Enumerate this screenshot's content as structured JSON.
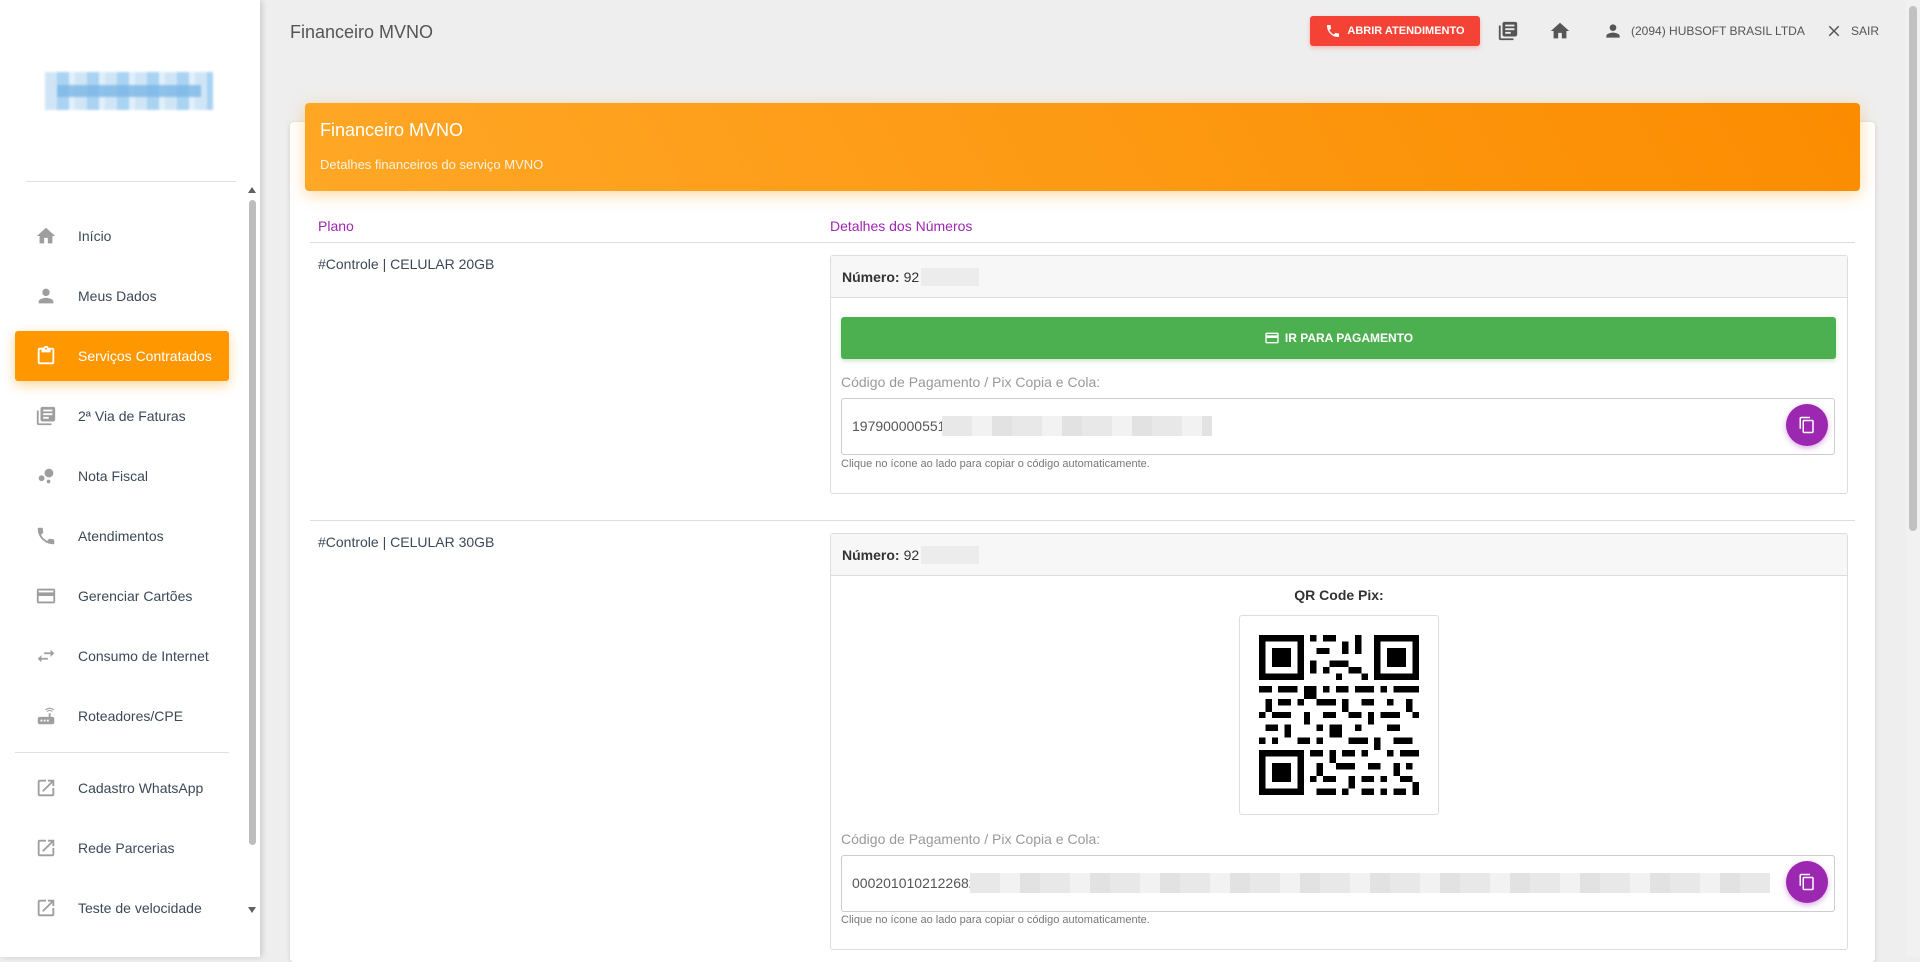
{
  "header": {
    "title": "Financeiro MVNO",
    "open_ticket_label": "ABRIR ATENDIMENTO",
    "user_label": "(2094) HUBSOFT BRASIL LTDA",
    "exit_label": "SAIR"
  },
  "sidebar": {
    "items": [
      {
        "label": "Início",
        "icon": "home-icon"
      },
      {
        "label": "Meus Dados",
        "icon": "person-icon"
      },
      {
        "label": "Serviços Contratados",
        "icon": "clipboard-icon",
        "active": true
      },
      {
        "label": "2ª Via de Faturas",
        "icon": "invoices-icon"
      },
      {
        "label": "Nota Fiscal",
        "icon": "bubbles-icon"
      },
      {
        "label": "Atendimentos",
        "icon": "phone-icon"
      },
      {
        "label": "Gerenciar Cartões",
        "icon": "credit-card-icon"
      },
      {
        "label": "Consumo de Internet",
        "icon": "transfer-icon"
      },
      {
        "label": "Roteadores/CPE",
        "icon": "router-icon"
      }
    ],
    "external_items": [
      {
        "label": "Cadastro WhatsApp",
        "icon": "external-link-icon"
      },
      {
        "label": "Rede Parcerias",
        "icon": "external-link-icon"
      },
      {
        "label": "Teste de velocidade",
        "icon": "external-link-icon"
      }
    ]
  },
  "card": {
    "title": "Financeiro MVNO",
    "subtitle": "Detalhes financeiros do serviço MVNO",
    "col_plan": "Plano",
    "col_details": "Detalhes dos Números"
  },
  "services": [
    {
      "plan": "#Controle | CELULAR 20GB",
      "number_label": "Número:",
      "number": "92",
      "pay_button": "IR PARA PAGAMENTO",
      "code_label": "Código de Pagamento / Pix Copia e Cola:",
      "code_value": "197900000551",
      "hint": "Clique no ícone ao lado para copiar o código automaticamente."
    },
    {
      "plan": "#Controle | CELULAR 30GB",
      "number_label": "Número:",
      "number": "92",
      "qr_label": "QR Code Pix:",
      "code_label": "Código de Pagamento / Pix Copia e Cola:",
      "code_value": "0002010102122682",
      "hint": "Clique no ícone ao lado para copiar o código automaticamente."
    }
  ],
  "colors": {
    "accent_orange": "#ff9800",
    "danger_red": "#f44336",
    "success_green": "#4caf50",
    "purple": "#9c27b0"
  }
}
